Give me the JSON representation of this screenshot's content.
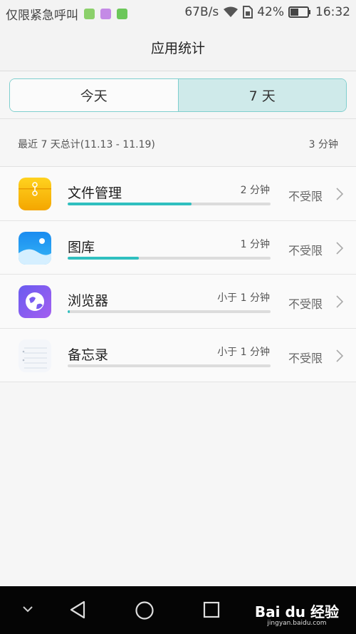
{
  "status_bar": {
    "carrier": "仅限紧急呼叫",
    "net_speed": "67B/s",
    "battery_percent": "42%",
    "time": "16:32",
    "icons": [
      "notification-app-icon",
      "notification-image-icon",
      "notification-chat-icon",
      "wifi-icon",
      "sim-icon",
      "battery-icon"
    ]
  },
  "header": {
    "title": "应用统计"
  },
  "tabs": [
    {
      "label": "今天",
      "active": false
    },
    {
      "label": "7 天",
      "active": true
    }
  ],
  "summary": {
    "label": "最近 7 天总计(11.13 - 11.19)",
    "total": "3 分钟"
  },
  "apps": [
    {
      "name": "文件管理",
      "time": "2 分钟",
      "usage_fraction": 0.61,
      "limit": "不受限",
      "icon": "file-manager-icon"
    },
    {
      "name": "图库",
      "time": "1 分钟",
      "usage_fraction": 0.35,
      "limit": "不受限",
      "icon": "gallery-icon"
    },
    {
      "name": "浏览器",
      "time": "小于 1 分钟",
      "usage_fraction": 0.01,
      "limit": "不受限",
      "icon": "browser-icon"
    },
    {
      "name": "备忘录",
      "time": "小于 1 分钟",
      "usage_fraction": 0.0,
      "limit": "不受限",
      "icon": "notepad-icon"
    }
  ],
  "nav": {
    "watermark": "Bai du 经验",
    "watermark_sub": "jingyan.baidu.com"
  },
  "colors": {
    "accent": "#2fbfbf",
    "tab_active_bg": "#cfeaea",
    "tab_border": "#7fcfce"
  }
}
